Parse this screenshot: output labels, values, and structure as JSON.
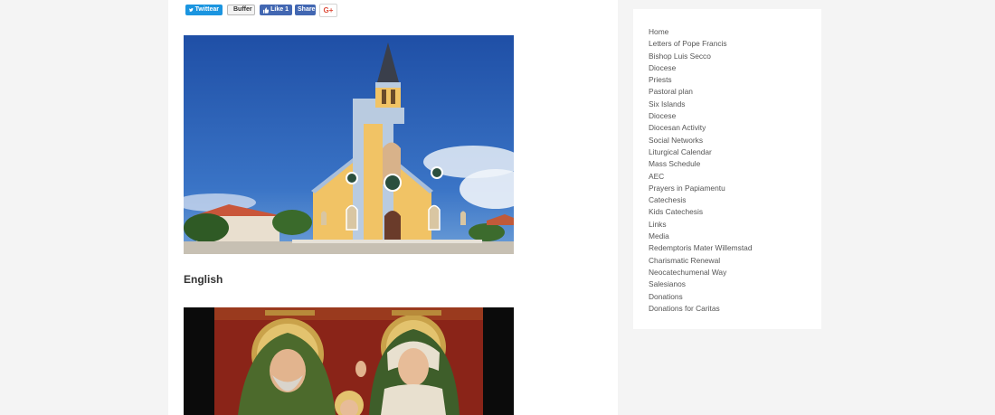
{
  "share": {
    "twitter_label": "Twittear",
    "buffer_label": "Buffer",
    "fb_like_label": "Like 1",
    "fb_share_label": "Share",
    "gplus_label": "G+"
  },
  "article": {
    "heading": "English"
  },
  "sidebar": {
    "items": [
      "Home",
      "Letters of Pope Francis",
      "Bishop Luis Secco",
      "Diocese",
      "Priests",
      "Pastoral plan",
      "Six Islands",
      "Diocese",
      "Diocesan Activity",
      "Social Networks",
      "Liturgical Calendar",
      "Mass Schedule",
      "AEC",
      "Prayers in Papiamentu",
      "Catechesis",
      "Kids Catechesis",
      "Links",
      "Media",
      "Redemptoris Mater Willemstad",
      "Charismatic Renewal",
      "Neocatechumenal Way",
      "Salesianos",
      "Donations",
      "Donations for Caritas"
    ]
  },
  "colors": {
    "twitter": "#1b95e0",
    "facebook": "#4267b2",
    "gplus": "#dd4b39",
    "page_bg": "#f4f4f4"
  }
}
